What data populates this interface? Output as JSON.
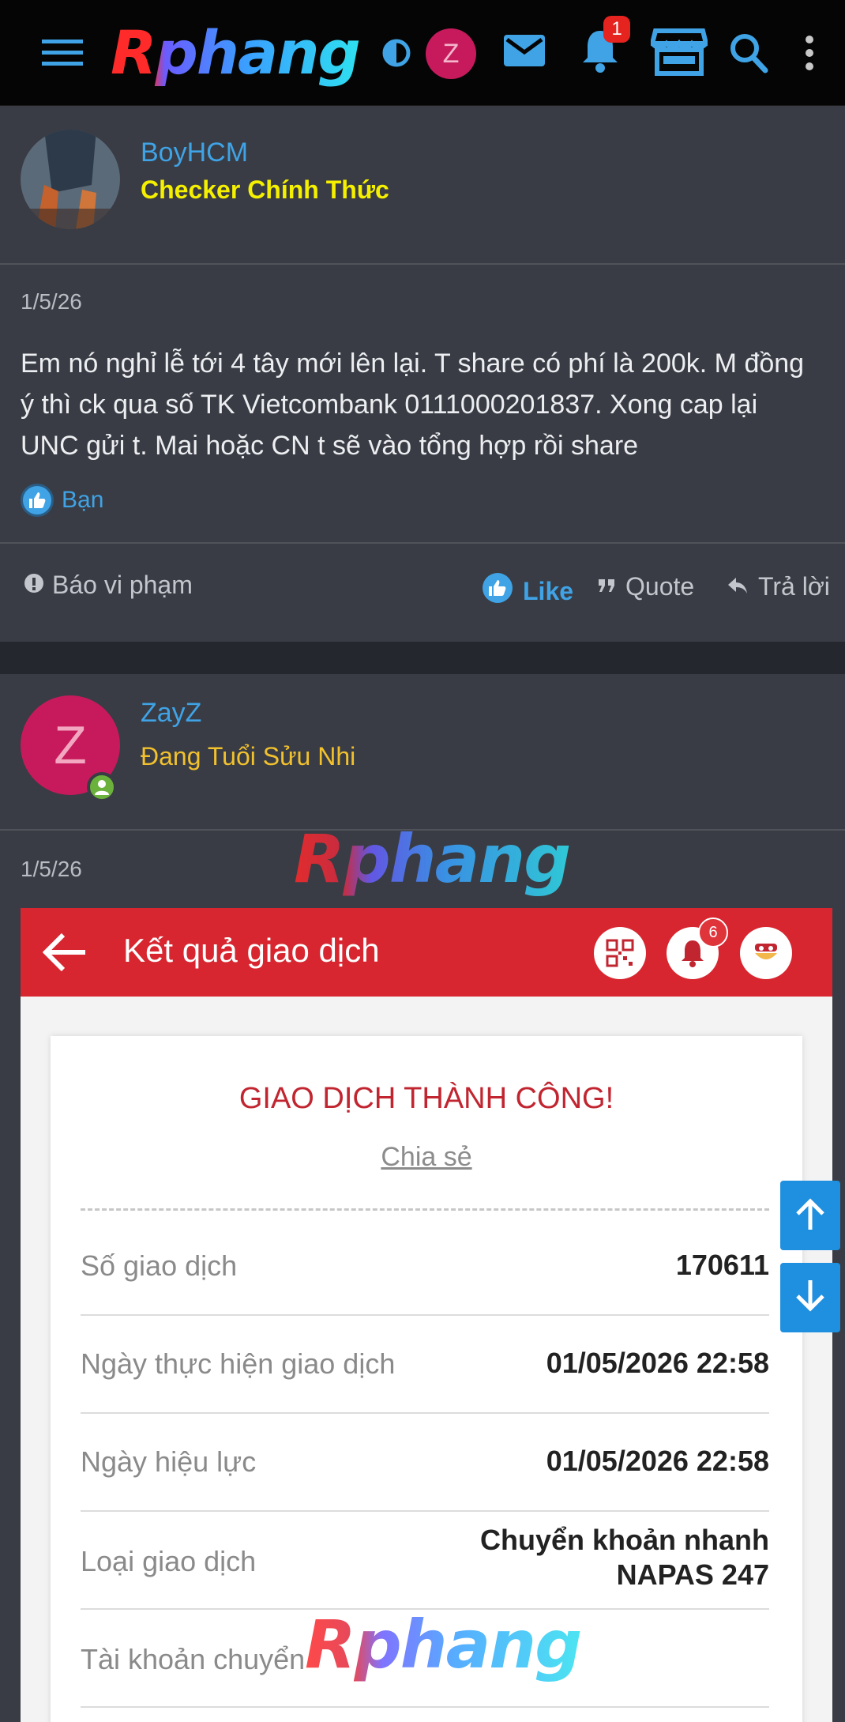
{
  "topbar": {
    "logo_text": "Rphang",
    "avatar_letter": "Z",
    "notifications_count": "1"
  },
  "posts": [
    {
      "username": "BoyHCM",
      "user_title": "Checker Chính Thức",
      "date": "1/5/26",
      "message": "Em nó nghỉ lễ tới 4 tây mới lên lại. T share có phí là 200k. M đồng ý thì ck qua số TK Vietcombank 0111000201837. Xong cap lại UNC gửi t. Mai hoặc CN t sẽ vào tổng hợp rồi share",
      "reaction_text": "Bạn",
      "report_label": "Báo vi phạm",
      "like_label": "Like",
      "quote_label": "Quote",
      "reply_label": "Trả lời"
    },
    {
      "username": "ZayZ",
      "avatar_letter": "Z",
      "user_title": "Đang Tuổi Sửu Nhi",
      "date": "1/5/26"
    }
  ],
  "watermark": "Rphang",
  "bank": {
    "title": "Kết quả giao dịch",
    "notification_count": "6",
    "status": "GIAO DỊCH THÀNH CÔNG!",
    "share_label": "Chia sẻ",
    "rows": [
      {
        "label": "Số giao dịch",
        "value": "170611"
      },
      {
        "label": "Ngày thực hiện giao dịch",
        "value": "01/05/2026 22:58"
      },
      {
        "label": "Ngày hiệu lực",
        "value": "01/05/2026 22:58"
      },
      {
        "label": "Loại giao dịch",
        "value": "Chuyển khoản nhanh",
        "value2": "NAPAS 247"
      },
      {
        "label": "Tài khoản chuyển",
        "value": ""
      }
    ]
  },
  "colors": {
    "accent": "#3fa3e6",
    "topbar_bg": "#050505",
    "card_bg": "#393c44",
    "bank_red": "#d7262f"
  }
}
